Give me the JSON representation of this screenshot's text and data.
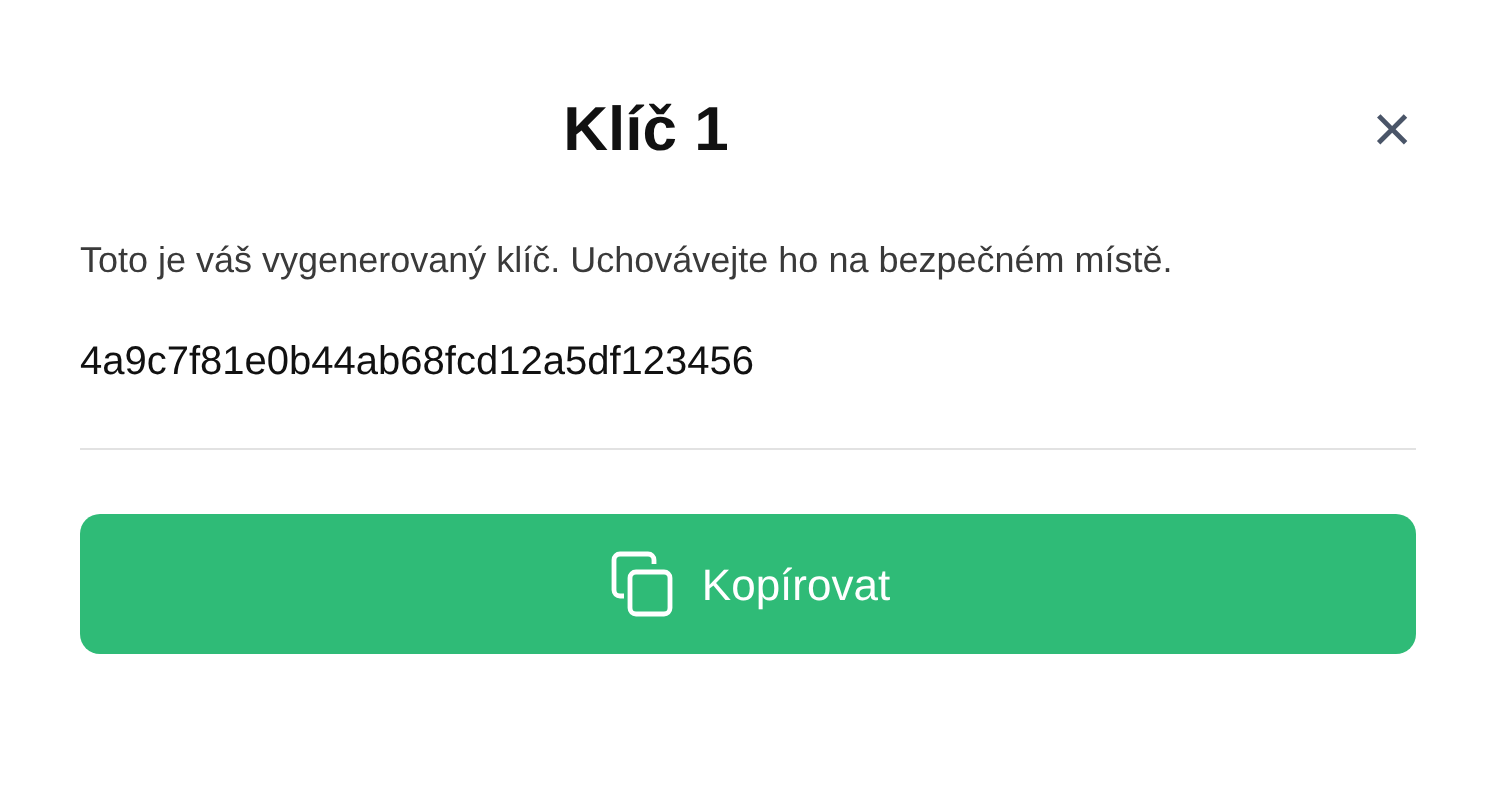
{
  "dialog": {
    "title": "Klíč 1",
    "close": "×",
    "message": "Toto je váš vygenerovaný klíč. Uchovávejte ho na bezpečném místě.",
    "key": "4a9c7f81e0b44ab68fcd12a5df123456",
    "button": {
      "label": "Kopírovat"
    }
  }
}
